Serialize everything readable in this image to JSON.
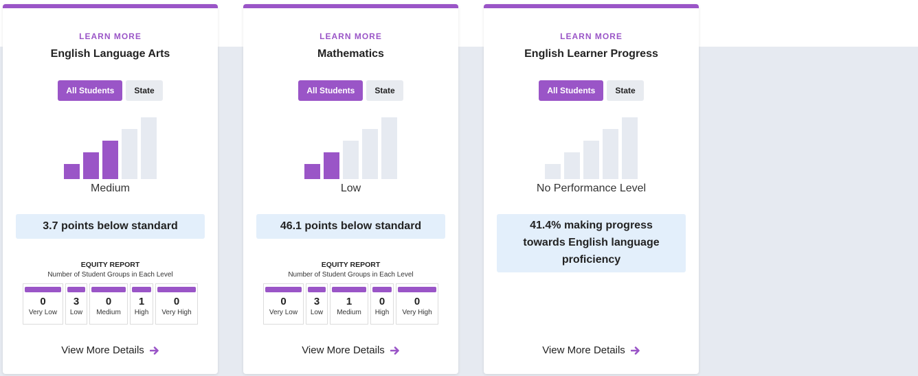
{
  "colors": {
    "accent": "#9a55c7",
    "bar_inactive": "#e6eaf1",
    "status_bg": "#e3effb",
    "page_bg": "#e6eaf1"
  },
  "cards": [
    {
      "learn_more": "LEARN MORE",
      "title": "English Language Arts",
      "toggle": {
        "all_students": "All Students",
        "state": "State"
      },
      "gauge_filled_levels": 3,
      "level": "Medium",
      "status": "3.7 points below standard",
      "equity": {
        "heading": "EQUITY REPORT",
        "subheading": "Number of Student Groups in Each Level",
        "levels": [
          {
            "count": "0",
            "label": "Very Low"
          },
          {
            "count": "3",
            "label": "Low"
          },
          {
            "count": "0",
            "label": "Medium"
          },
          {
            "count": "1",
            "label": "High"
          },
          {
            "count": "0",
            "label": "Very High"
          }
        ]
      },
      "details": "View More Details",
      "details_icon": "arrow-right-icon"
    },
    {
      "learn_more": "LEARN MORE",
      "title": "Mathematics",
      "toggle": {
        "all_students": "All Students",
        "state": "State"
      },
      "gauge_filled_levels": 2,
      "level": "Low",
      "status": "46.1 points below standard",
      "equity": {
        "heading": "EQUITY REPORT",
        "subheading": "Number of Student Groups in Each Level",
        "levels": [
          {
            "count": "0",
            "label": "Very Low"
          },
          {
            "count": "3",
            "label": "Low"
          },
          {
            "count": "1",
            "label": "Medium"
          },
          {
            "count": "0",
            "label": "High"
          },
          {
            "count": "0",
            "label": "Very High"
          }
        ]
      },
      "details": "View More Details",
      "details_icon": "arrow-right-icon"
    },
    {
      "learn_more": "LEARN MORE",
      "title": "English Learner Progress",
      "toggle": {
        "all_students": "All Students",
        "state": "State"
      },
      "gauge_filled_levels": 0,
      "level": "No Performance Level",
      "status": "41.4% making progress towards English language proficiency",
      "details": "View More Details",
      "details_icon": "arrow-right-icon"
    }
  ]
}
